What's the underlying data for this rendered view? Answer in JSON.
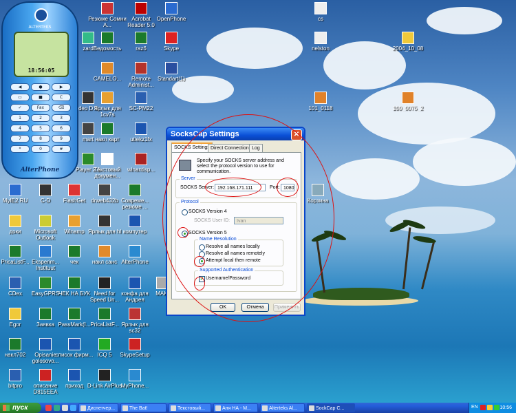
{
  "desktop_icons": [
    {
      "id": "i-resume",
      "label": "Резюме Сомни А...",
      "color": "#c33"
    },
    {
      "id": "i-acrobat",
      "label": "Acrobat Reader 5.0",
      "color": "#b00"
    },
    {
      "id": "i-openphone",
      "label": "OpenPhone",
      "color": "#2a6bd0"
    },
    {
      "id": "i-cs",
      "label": "cs",
      "color": "#eee"
    },
    {
      "id": "i-wizard",
      "label": "zard",
      "color": "#3b8"
    },
    {
      "id": "i-vedomost",
      "label": "Ведомость",
      "color": "#1b7a2b"
    },
    {
      "id": "i-raz6",
      "label": "raz6",
      "color": "#1b7a2b"
    },
    {
      "id": "i-skype",
      "label": "Skype",
      "color": "#d22"
    },
    {
      "id": "i-nelston",
      "label": "nelston",
      "color": "#eee"
    },
    {
      "id": "i-folder2004",
      "label": "2004_10_08",
      "color": "#f0c93a"
    },
    {
      "id": "i-camelot",
      "label": "CAMELO...",
      "color": "#e08a2a"
    },
    {
      "id": "i-remote",
      "label": "Remote Administ...",
      "color": "#b3322a"
    },
    {
      "id": "i-standart",
      "label": "Standart(1)",
      "color": "#2a4fa0"
    },
    {
      "id": "i-video5",
      "label": "deo D 5",
      "color": "#333"
    },
    {
      "id": "i-yarlyk1",
      "label": "Ярлык для 1cv7s",
      "color": "#e8a030"
    },
    {
      "id": "i-scpm22",
      "label": "SC-PM22",
      "color": "#2a5fb0"
    },
    {
      "id": "i-101",
      "label": "101_0118",
      "color": "#e0822a"
    },
    {
      "id": "i-100",
      "label": "100_0075_2",
      "color": "#e0822a"
    },
    {
      "id": "i-start",
      "label": "mart",
      "color": "#444"
    },
    {
      "id": "i-naklkart",
      "label": "накл карт",
      "color": "#1b7a2b"
    },
    {
      "id": "i-utiekz",
      "label": "utiekz1fx",
      "color": "#1b55b0"
    },
    {
      "id": "i-drw",
      "label": "Dr",
      "color": "#777"
    },
    {
      "id": "i-player",
      "label": "Player 2.1",
      "color": "#2a8a2a"
    },
    {
      "id": "i-textdoc",
      "label": "Текстовый докумен...",
      "color": "#fff"
    },
    {
      "id": "i-winantisp",
      "label": "winantisp...",
      "color": "#a22"
    },
    {
      "id": "i-korzina",
      "label": "Корзина",
      "color": "#8ab"
    },
    {
      "id": "i-myie",
      "label": "MyIE2 RU",
      "color": "#2a6bd0"
    },
    {
      "id": "i-cd",
      "label": "C-D",
      "color": "#333"
    },
    {
      "id": "i-flashget",
      "label": "FlashGet",
      "color": "#d33"
    },
    {
      "id": "i-drweb",
      "label": "drweb432b",
      "color": "#444"
    },
    {
      "id": "i-sovrem",
      "label": "Совреме... резюме ...",
      "color": "#1b7a2b"
    },
    {
      "id": "i-doki",
      "label": "доки",
      "color": "#f0c93a"
    },
    {
      "id": "i-outlook",
      "label": "Microsoft Outlook",
      "color": "#cc3"
    },
    {
      "id": "i-winamp",
      "label": "Winamp",
      "color": "#e8a030"
    },
    {
      "id": "i-yarlyk-hl",
      "label": "Ярлык для hl",
      "color": "#333"
    },
    {
      "id": "i-komputer",
      "label": "компутер",
      "color": "#1b55b0"
    },
    {
      "id": "i-pricelist",
      "label": "PricaListF...",
      "color": "#1b7a2b"
    },
    {
      "id": "i-eksperim",
      "label": "Eksperim... Instituut",
      "color": "#2a7ad0"
    },
    {
      "id": "i-chek",
      "label": "чек",
      "color": "#1b7a2b"
    },
    {
      "id": "i-naklsans",
      "label": "накл санс",
      "color": "#e08a2a"
    },
    {
      "id": "i-alterphone",
      "label": "AlterPhone",
      "color": "#2a8ad0"
    },
    {
      "id": "i-cdex",
      "label": "CDex",
      "color": "#2a5fb0"
    },
    {
      "id": "i-easygprs",
      "label": "EasyGPRS",
      "color": "#2a8a2a"
    },
    {
      "id": "i-chek-buk",
      "label": "ЧЕК НА БУК",
      "color": "#1b7a2b"
    },
    {
      "id": "i-nfs",
      "label": "Need for Speed Un...",
      "color": "#222"
    },
    {
      "id": "i-konfa",
      "label": "конфа для Андрея",
      "color": "#1b55b0"
    },
    {
      "id": "i-maki",
      "label": "MAKI",
      "color": "#aaa"
    },
    {
      "id": "i-egor",
      "label": "Egor",
      "color": "#f0c93a"
    },
    {
      "id": "i-zayavka",
      "label": "Заявка",
      "color": "#1b7a2b"
    },
    {
      "id": "i-passmark",
      "label": "PassMark(I...",
      "color": "#1b7a2b"
    },
    {
      "id": "i-pricelist2",
      "label": "PricaListF...",
      "color": "#1b7a2b"
    },
    {
      "id": "i-yarlyk-sc32",
      "label": "Ярлык для sc32",
      "color": "#b33"
    },
    {
      "id": "i-nakl702",
      "label": "накл702",
      "color": "#1b7a2b"
    },
    {
      "id": "i-opisanie",
      "label": "Opisanie golosovo...",
      "color": "#1b55b0"
    },
    {
      "id": "i-spisok",
      "label": "список фирм...",
      "color": "#1b55b0"
    },
    {
      "id": "i-icq",
      "label": "ICQ 5",
      "color": "#2a2"
    },
    {
      "id": "i-skypesetup",
      "label": "SkypeSetup",
      "color": "#c22"
    },
    {
      "id": "i-bitpro",
      "label": "bitpro",
      "color": "#2a5fb0"
    },
    {
      "id": "i-opisanie2",
      "label": "описание D815EEA",
      "color": "#c22"
    },
    {
      "id": "i-prihod",
      "label": "приход",
      "color": "#1b55b0"
    },
    {
      "id": "i-dlink",
      "label": "D-Link AirPlus",
      "color": "#222"
    },
    {
      "id": "i-myphone",
      "label": "MyPhone...",
      "color": "#2a8ad0"
    }
  ],
  "phone": {
    "brand": "ALTERTEKS",
    "time": "18:56:05",
    "name": "AlterPhone",
    "keys": [
      "◀",
      "●",
      "▶",
      "▭",
      "■",
      "C",
      "✓",
      "Fax",
      "⌫",
      "1",
      "2",
      "3",
      "4",
      "5",
      "6",
      "7",
      "8",
      "9",
      "*",
      "0",
      "#"
    ]
  },
  "dialog": {
    "title": "SocksCap Settings",
    "close": "✕",
    "tabs": [
      "SOCKS Settings",
      "Direct Connections",
      "Log"
    ],
    "description": "Specify your SOCKS server address and select the protocol version to use for communication.",
    "server": {
      "legend": "Server",
      "server_label": "SOCKS Server:",
      "server_value": "192.168.171.111",
      "port_label": "Port:",
      "port_value": "1080"
    },
    "protocol": {
      "legend": "Protocol",
      "v4_label": "SOCKS Version 4",
      "userid_label": "SOCKS User ID:",
      "userid_value": "Ivan",
      "v5_label": "SOCKS Version 5",
      "v5_selected": true,
      "name_resolution": {
        "legend": "Name Resolution",
        "options": [
          "Resolve all names locally",
          "Resolve all names remotely",
          "Attempt local then remote"
        ],
        "selected_index": 2
      },
      "auth": {
        "legend": "Supported Authentication",
        "option": "Username/Password",
        "checked": true
      }
    },
    "buttons": {
      "ok": "OK",
      "cancel": "Отмена",
      "apply": "Применить"
    }
  },
  "taskbar": {
    "start_label": "пуск",
    "tasks": [
      {
        "label": "Диспетчер...",
        "active": false
      },
      {
        "label": "The Bat!",
        "active": false
      },
      {
        "label": "Текстовый...",
        "active": false
      },
      {
        "label": "Аня НА - М...",
        "active": false
      },
      {
        "label": "Alterteks Al...",
        "active": false
      },
      {
        "label": "SockCap C...",
        "active": true
      }
    ],
    "lang": "EN",
    "clock": "10:56"
  }
}
